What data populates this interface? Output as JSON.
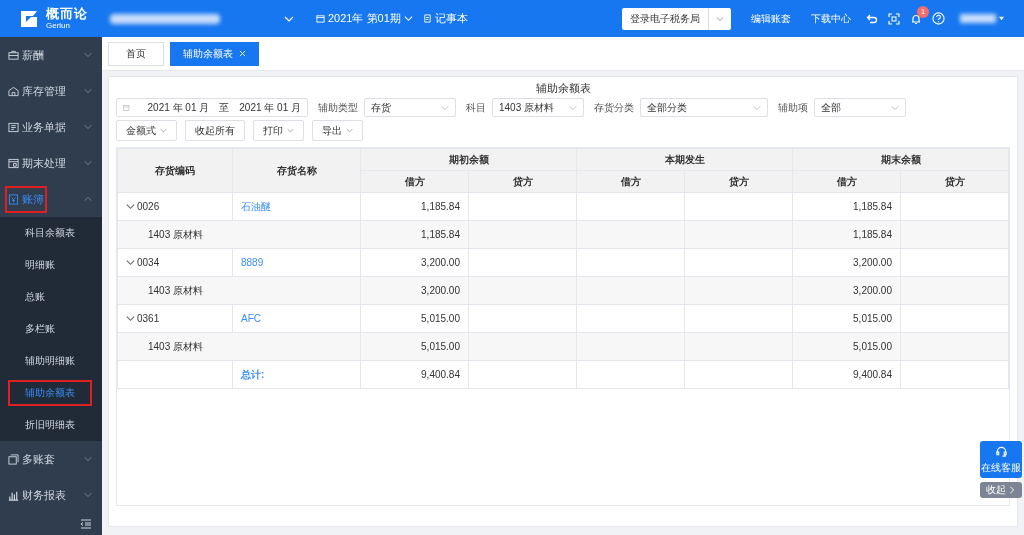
{
  "header": {
    "logo_name": "概而论",
    "logo_sub": "Gerlun",
    "period": "2021年 第01期",
    "notebook": "记事本",
    "tax_button": "登录电子税务局",
    "links": [
      "编辑账套",
      "下载中心"
    ],
    "notification_count": "1"
  },
  "sidebar": {
    "items": [
      {
        "label": "薪酬",
        "expanded": false,
        "highlighted": false
      },
      {
        "label": "库存管理",
        "expanded": false,
        "highlighted": false
      },
      {
        "label": "业务单据",
        "expanded": false,
        "highlighted": false
      },
      {
        "label": "期末处理",
        "expanded": false,
        "highlighted": false
      },
      {
        "label": "账簿",
        "expanded": true,
        "highlighted": true,
        "children": [
          {
            "label": "科目余额表",
            "selected": false,
            "highlighted": false
          },
          {
            "label": "明细账",
            "selected": false,
            "highlighted": false
          },
          {
            "label": "总账",
            "selected": false,
            "highlighted": false
          },
          {
            "label": "多栏账",
            "selected": false,
            "highlighted": false
          },
          {
            "label": "辅助明细账",
            "selected": false,
            "highlighted": false
          },
          {
            "label": "辅助余额表",
            "selected": true,
            "highlighted": true
          },
          {
            "label": "折旧明细表",
            "selected": false,
            "highlighted": false
          }
        ]
      },
      {
        "label": "多账套",
        "expanded": false,
        "highlighted": false
      },
      {
        "label": "财务报表",
        "expanded": false,
        "highlighted": false
      }
    ]
  },
  "tabs": [
    {
      "label": "首页",
      "selected": false,
      "closable": false
    },
    {
      "label": "辅助余额表",
      "selected": true,
      "closable": true
    }
  ],
  "report": {
    "title": "辅助余额表",
    "date_from": "2021 年 01 月",
    "date_sep": "至",
    "date_to": "2021 年 01 月",
    "filters": [
      {
        "label": "辅助类型",
        "value": "存货"
      },
      {
        "label": "科目",
        "value": "1403 原材料"
      },
      {
        "label": "存货分类",
        "value": "全部分类"
      },
      {
        "label": "辅助项",
        "value": "全部"
      }
    ],
    "buttons": [
      {
        "label": "金额式",
        "dropdown": true
      },
      {
        "label": "收起所有",
        "dropdown": false
      },
      {
        "label": "打印",
        "dropdown": true
      },
      {
        "label": "导出",
        "dropdown": true
      }
    ],
    "table": {
      "columns": [
        "存货编码",
        "存货名称"
      ],
      "groups": [
        {
          "label": "期初余额",
          "subcolumns": [
            "借方",
            "贷方"
          ]
        },
        {
          "label": "本期发生",
          "subcolumns": [
            "借方",
            "贷方"
          ]
        },
        {
          "label": "期末余额",
          "subcolumns": [
            "借方",
            "贷方"
          ]
        }
      ],
      "rows": [
        {
          "kind": "group",
          "expanded": true,
          "code": "0026",
          "name": "石油醚",
          "amounts": {
            "opening_debit": "1,185.84",
            "closing_debit": "1,185.84"
          }
        },
        {
          "kind": "detail",
          "account": "1403 原材料",
          "amounts": {
            "opening_debit": "1,185.84",
            "closing_debit": "1,185.84"
          }
        },
        {
          "kind": "group",
          "expanded": true,
          "code": "0034",
          "name": "8889",
          "amounts": {
            "opening_debit": "3,200.00",
            "closing_debit": "3,200.00"
          }
        },
        {
          "kind": "detail",
          "account": "1403 原材料",
          "amounts": {
            "opening_debit": "3,200.00",
            "closing_debit": "3,200.00"
          }
        },
        {
          "kind": "group",
          "expanded": true,
          "code": "0361",
          "name": "AFC",
          "amounts": {
            "opening_debit": "5,015.00",
            "closing_debit": "5,015.00"
          }
        },
        {
          "kind": "detail",
          "account": "1403 原材料",
          "amounts": {
            "opening_debit": "5,015.00",
            "closing_debit": "5,015.00"
          }
        },
        {
          "kind": "total",
          "label": "总计:",
          "amounts": {
            "opening_debit": "9,400.84",
            "closing_debit": "9,400.84"
          }
        }
      ]
    }
  },
  "service": {
    "label": "在线客服",
    "collapse": "收起"
  }
}
